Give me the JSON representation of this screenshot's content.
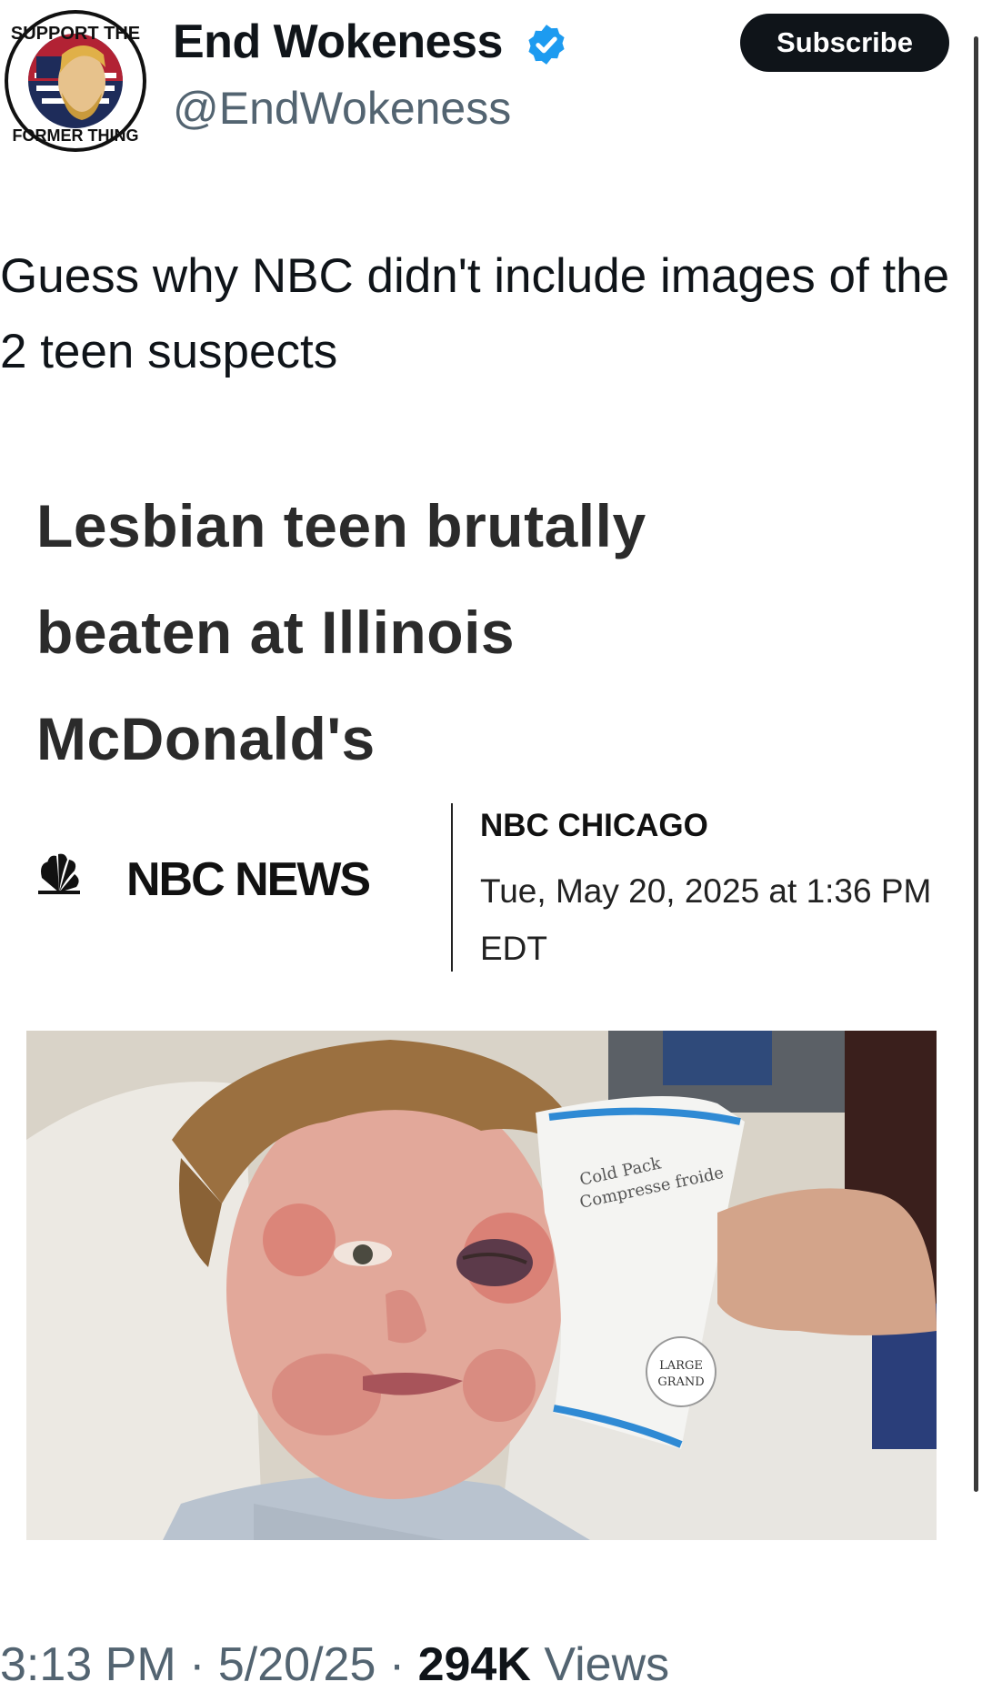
{
  "author": {
    "display_name": "End Wokeness",
    "handle": "@EndWokeness",
    "avatar_icon": "i-support-the-former-thing-badge",
    "avatar_lettering": "I SUPPORT THE FORMER THING",
    "verified_icon": "verified-badge-icon",
    "verified_color": "#1d9bf0"
  },
  "subscribe_label": "Subscribe",
  "tweet_text": "Guess why NBC didn't include images of the 2 teen suspects",
  "article": {
    "headline": "Lesbian teen brutally beaten at Illinois McDonald's",
    "publisher_icon": "nbc-peacock-icon",
    "publisher": "NBC NEWS",
    "source": "NBC CHICAGO",
    "datetime": "Tue, May 20, 2025 at 1:36 PM EDT",
    "photo_icon": "hospital-patient-photo",
    "photo_lettering": "Cardinal Cold Pack Compresse froide LARGE GRAND"
  },
  "meta": {
    "time": "3:13 PM",
    "date": "5/20/25",
    "views": "294K",
    "views_label": "Views"
  }
}
